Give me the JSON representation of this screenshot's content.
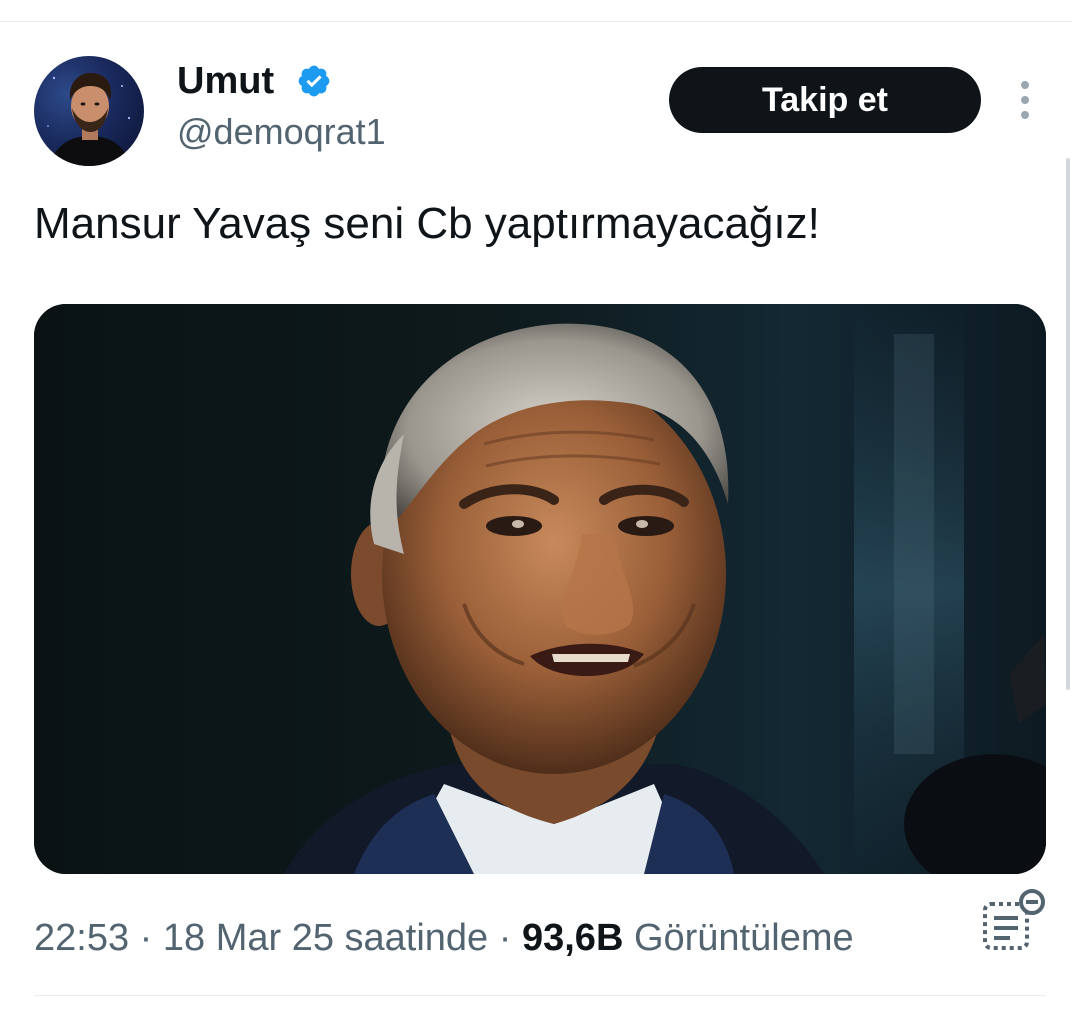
{
  "author": {
    "display_name": "Umut",
    "handle": "@demoqrat1",
    "verified": true,
    "avatar_icon": "user-avatar"
  },
  "actions": {
    "follow_label": "Takip et",
    "more_icon": "more-vertical-icon"
  },
  "tweet": {
    "text": "Mansur Yavaş seni Cb yaptırmayacağız!",
    "media_alt": "photo-of-man"
  },
  "meta": {
    "time": "22:53",
    "separator1": " · ",
    "date": "18 Mar 25 saatinde",
    "separator2": " · ",
    "views_count": "93,6B",
    "views_label": " Görüntüleme",
    "analytics_icon": "analytics-icon"
  },
  "colors": {
    "text_primary": "#0f1419",
    "text_secondary": "#536471",
    "verified_blue": "#1d9bf0",
    "button_bg": "#0f1419",
    "divider": "#e6ecf0"
  }
}
